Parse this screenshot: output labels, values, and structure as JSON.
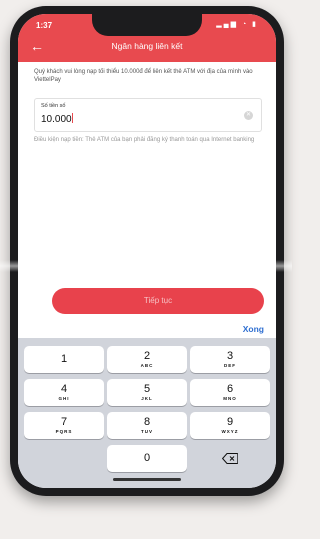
{
  "status": {
    "time": "1:37",
    "icons": "wifi-icon battery-icon"
  },
  "header": {
    "title": "Ngân hàng liên kết"
  },
  "notice": "Quý khách vui lòng nạp tối thiểu 10.000đ để liên kết thẻ ATM với địa của mình vào ViettelPay",
  "amount": {
    "label": "Số tiền số",
    "value": "10.000"
  },
  "condition": "Điều kiện nạp tiền: Thẻ ATM của bạn phải đăng ký thanh toán qua Internet banking",
  "continue_label": "Tiếp tục",
  "done_label": "Xong",
  "keypad": {
    "keys": [
      {
        "digit": "1",
        "letters": ""
      },
      {
        "digit": "2",
        "letters": "ABC"
      },
      {
        "digit": "3",
        "letters": "DEF"
      },
      {
        "digit": "4",
        "letters": "GHI"
      },
      {
        "digit": "5",
        "letters": "JKL"
      },
      {
        "digit": "6",
        "letters": "MNO"
      },
      {
        "digit": "7",
        "letters": "PQRS"
      },
      {
        "digit": "8",
        "letters": "TUV"
      },
      {
        "digit": "9",
        "letters": "WXYZ"
      },
      {
        "digit": "0",
        "letters": ""
      }
    ]
  },
  "colors": {
    "brand": "#e84a4f",
    "button": "#e8424c",
    "link": "#2f6fd1",
    "keypad_bg": "#d1d4db"
  }
}
